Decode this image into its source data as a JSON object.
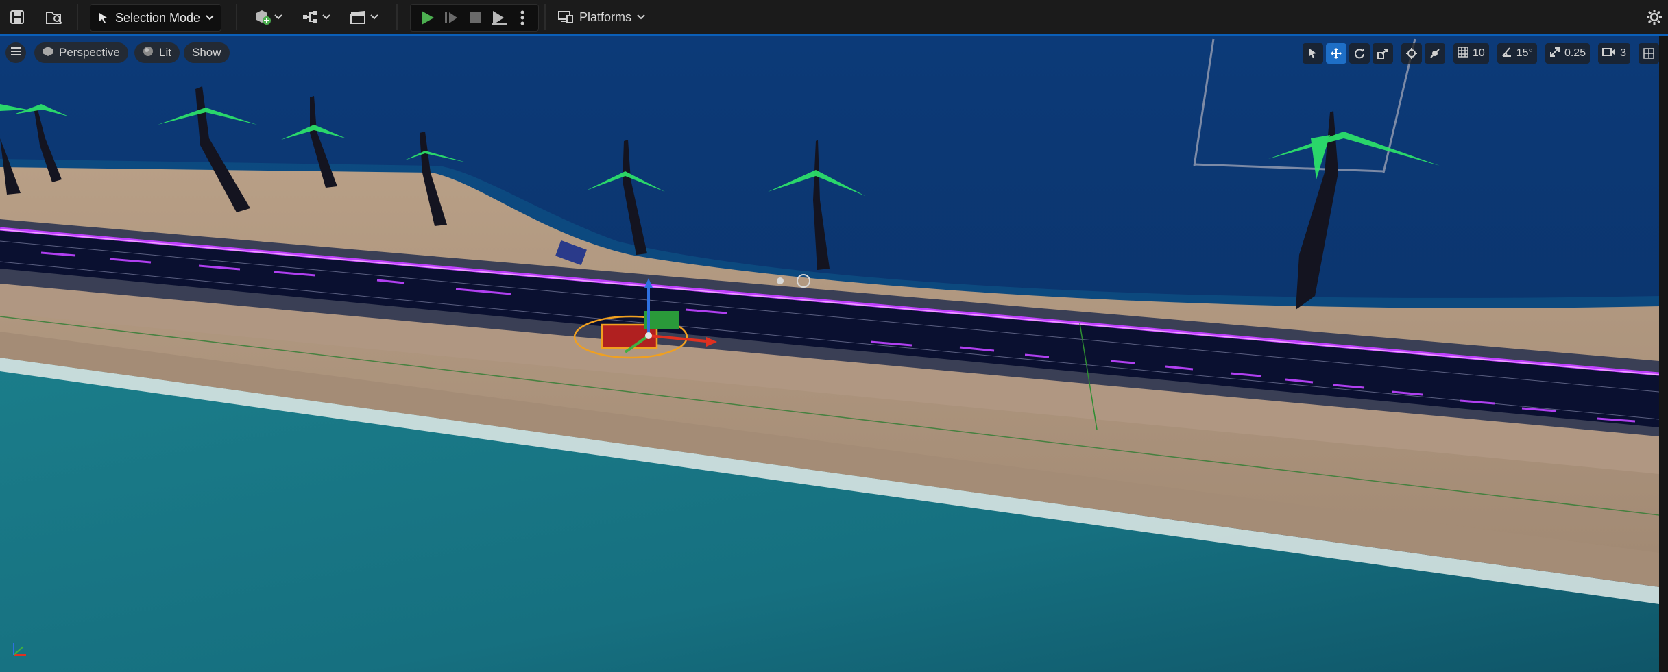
{
  "toolbar": {
    "mode_label": "Selection Mode",
    "platforms_label": "Platforms"
  },
  "viewport": {
    "view_label": "Perspective",
    "lighting_label": "Lit",
    "show_label": "Show",
    "grid_snap_value": "10",
    "rotation_snap_value": "15°",
    "scale_snap_value": "0.25",
    "camera_speed_value": "3"
  },
  "colors": {
    "toolbar_bg": "#1b1b1b",
    "accent": "#1e6fc7",
    "play_green": "#4caf50",
    "road_neon": "#c040ff",
    "ocean_deep": "#0b2f66",
    "sea_shallow": "#1f8a8f",
    "sand": "#b49a83"
  },
  "icons": [
    "save-icon",
    "content-browser-icon",
    "selection-mode-icon",
    "add-actor-icon",
    "blueprint-icon",
    "cinematics-icon",
    "play-icon",
    "step-icon",
    "stop-icon",
    "eject-icon",
    "more-options-icon",
    "platforms-icon",
    "settings-icon",
    "hamburger-icon",
    "perspective-cube-icon",
    "lit-sphere-icon",
    "select-tool-icon",
    "translate-tool-icon",
    "rotate-tool-icon",
    "scale-tool-icon",
    "world-local-icon",
    "surface-snap-icon",
    "grid-icon",
    "angle-icon",
    "scale-snap-icon",
    "camera-speed-icon",
    "layout-icon"
  ]
}
